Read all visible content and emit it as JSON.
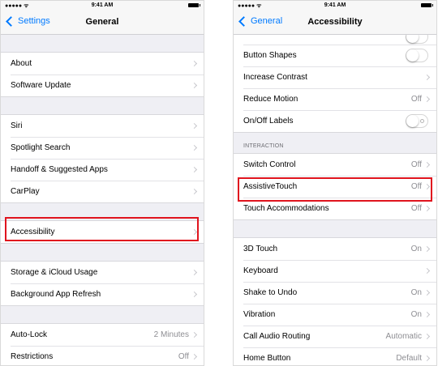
{
  "status": {
    "time": "9:41 AM",
    "signal": "●●●●● ᯤ"
  },
  "left": {
    "back_label": "Settings",
    "title": "General",
    "groups": [
      {
        "items": [
          {
            "label": "About"
          },
          {
            "label": "Software Update"
          }
        ]
      },
      {
        "items": [
          {
            "label": "Siri"
          },
          {
            "label": "Spotlight Search"
          },
          {
            "label": "Handoff & Suggested Apps"
          },
          {
            "label": "CarPlay"
          }
        ]
      },
      {
        "items": [
          {
            "label": "Accessibility"
          }
        ]
      },
      {
        "items": [
          {
            "label": "Storage & iCloud Usage"
          },
          {
            "label": "Background App Refresh"
          }
        ]
      },
      {
        "items": [
          {
            "label": "Auto-Lock",
            "value": "2 Minutes"
          },
          {
            "label": "Restrictions",
            "value": "Off"
          }
        ]
      }
    ]
  },
  "right": {
    "back_label": "General",
    "title": "Accessibility",
    "top_items": [
      {
        "label": "Button Shapes",
        "toggle": false
      },
      {
        "label": "Increase Contrast"
      },
      {
        "label": "Reduce Motion",
        "value": "Off"
      },
      {
        "label": "On/Off Labels",
        "toggle": false
      }
    ],
    "interaction_header": "INTERACTION",
    "interaction_items": [
      {
        "label": "Switch Control",
        "value": "Off"
      },
      {
        "label": "AssistiveTouch",
        "value": "Off"
      },
      {
        "label": "Touch Accommodations",
        "value": "Off"
      }
    ],
    "bottom_items": [
      {
        "label": "3D Touch",
        "value": "On"
      },
      {
        "label": "Keyboard"
      },
      {
        "label": "Shake to Undo",
        "value": "On"
      },
      {
        "label": "Vibration",
        "value": "On"
      },
      {
        "label": "Call Audio Routing",
        "value": "Automatic"
      },
      {
        "label": "Home Button",
        "value": "Default"
      }
    ]
  },
  "colors": {
    "accent": "#007aff",
    "highlight": "#e0141e",
    "background": "#efeff4"
  }
}
